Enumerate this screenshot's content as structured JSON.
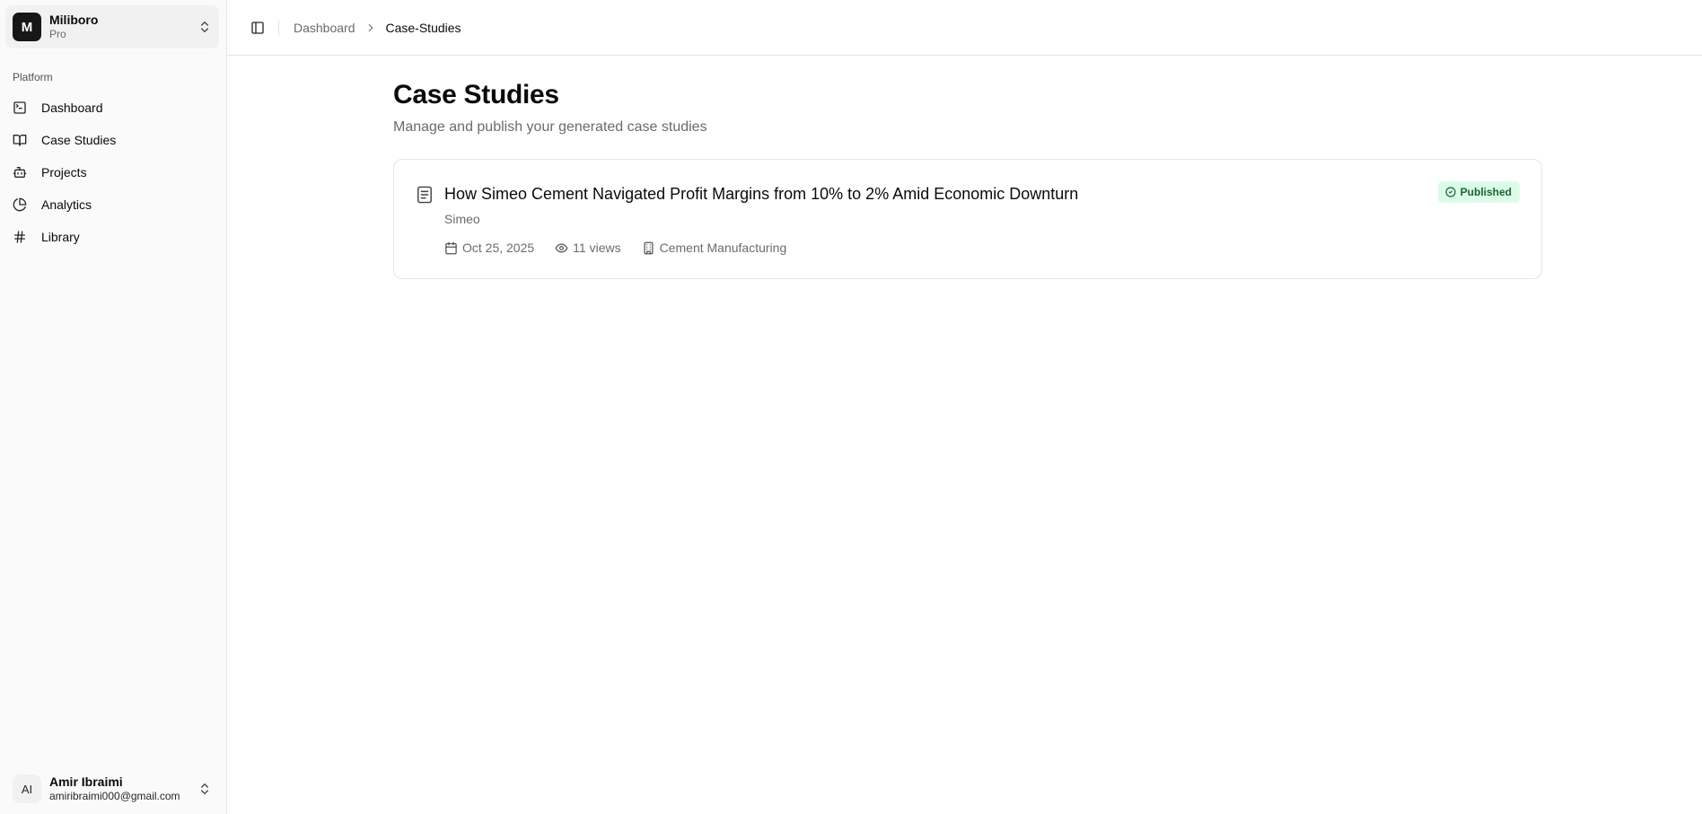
{
  "team": {
    "logo_letter": "M",
    "name": "Miliboro",
    "plan": "Pro"
  },
  "sidebar": {
    "group_label": "Platform",
    "items": [
      {
        "label": "Dashboard",
        "icon": "terminal-square-icon"
      },
      {
        "label": "Case Studies",
        "icon": "book-open-icon"
      },
      {
        "label": "Projects",
        "icon": "bot-icon"
      },
      {
        "label": "Analytics",
        "icon": "pie-chart-icon"
      },
      {
        "label": "Library",
        "icon": "hash-icon"
      }
    ]
  },
  "user": {
    "initials": "AI",
    "name": "Amir Ibraimi",
    "email": "amiribraimi000@gmail.com"
  },
  "breadcrumb": {
    "parent": "Dashboard",
    "current": "Case-Studies"
  },
  "page": {
    "title": "Case Studies",
    "subtitle": "Manage and publish your generated case studies"
  },
  "case_studies": [
    {
      "title": "How Simeo Cement Navigated Profit Margins from 10% to 2% Amid Economic Downturn",
      "company": "Simeo",
      "date": "Oct 25, 2025",
      "views": "11 views",
      "industry": "Cement Manufacturing",
      "status": "Published"
    }
  ],
  "colors": {
    "sidebar_bg": "#fafafa",
    "badge_bg": "#dcfce7",
    "badge_text": "#166534",
    "logo_bg": "#171717"
  }
}
